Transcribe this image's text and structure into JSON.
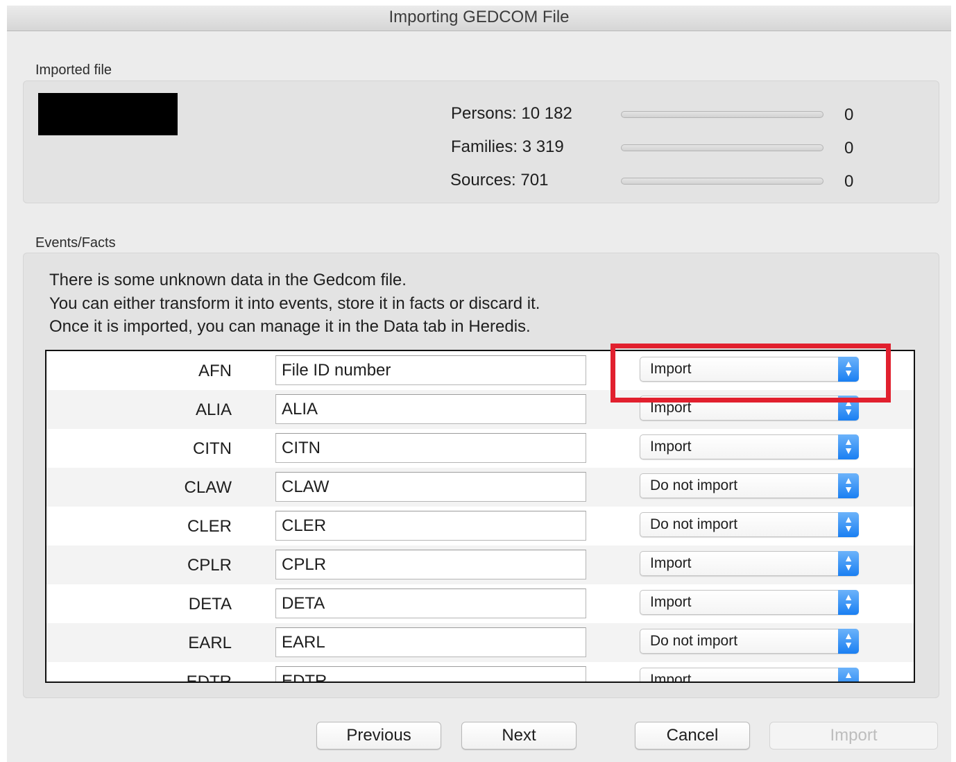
{
  "window": {
    "title": "Importing GEDCOM File"
  },
  "imported_file": {
    "section_label": "Imported file",
    "stats": [
      {
        "label": "Persons:",
        "value": "10 182",
        "count": "0",
        "progress": 0
      },
      {
        "label": "Families:",
        "value": "3 319",
        "count": "0",
        "progress": 0
      },
      {
        "label": "Sources:",
        "value": "701",
        "count": "0",
        "progress": 0
      }
    ]
  },
  "events_facts": {
    "section_label": "Events/Facts",
    "info_lines": [
      "There is some unknown data in the Gedcom file.",
      "You can either transform it into events, store it in facts or discard it.",
      "Once it is imported, you can manage it in the Data tab in Heredis."
    ],
    "rows": [
      {
        "tag": "AFN",
        "name": "File ID number",
        "action": "Import"
      },
      {
        "tag": "ALIA",
        "name": "ALIA",
        "action": "Import"
      },
      {
        "tag": "CITN",
        "name": "CITN",
        "action": "Import"
      },
      {
        "tag": "CLAW",
        "name": "CLAW",
        "action": "Do not import"
      },
      {
        "tag": "CLER",
        "name": "CLER",
        "action": "Do not import"
      },
      {
        "tag": "CPLR",
        "name": "CPLR",
        "action": "Import"
      },
      {
        "tag": "DETA",
        "name": "DETA",
        "action": "Import"
      },
      {
        "tag": "EARL",
        "name": "EARL",
        "action": "Do not import"
      },
      {
        "tag": "EDTR",
        "name": "EDTR",
        "action": "Import"
      }
    ]
  },
  "buttons": {
    "previous": "Previous",
    "next": "Next",
    "cancel": "Cancel",
    "import": "Import"
  },
  "colors": {
    "highlight": "#e1202e",
    "accent": "#1a7ff2"
  }
}
